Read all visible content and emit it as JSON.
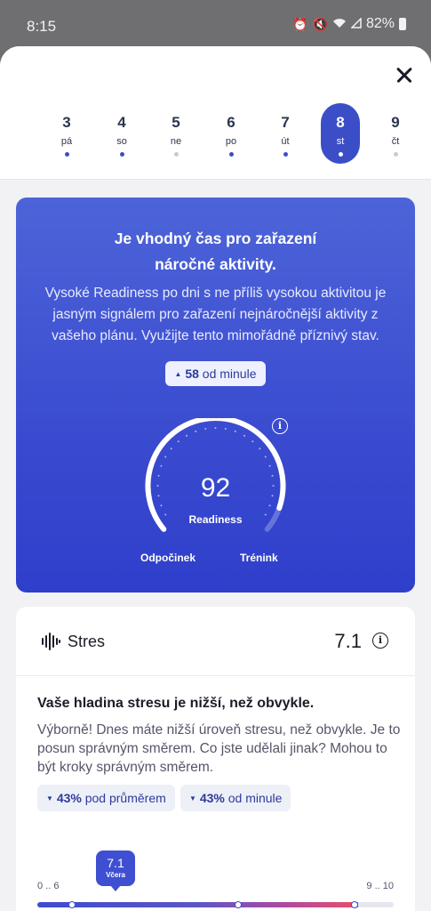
{
  "status_bar": {
    "time": "8:15",
    "battery": "82%"
  },
  "days": [
    {
      "num": "3",
      "weekday": "pá",
      "dot": "filled"
    },
    {
      "num": "4",
      "weekday": "so",
      "dot": "filled"
    },
    {
      "num": "5",
      "weekday": "ne",
      "dot": "faint"
    },
    {
      "num": "6",
      "weekday": "po",
      "dot": "filled"
    },
    {
      "num": "7",
      "weekday": "út",
      "dot": "filled"
    },
    {
      "num": "8",
      "weekday": "st",
      "dot": "filled",
      "selected": true
    },
    {
      "num": "9",
      "weekday": "čt",
      "dot": "faint"
    }
  ],
  "readiness": {
    "title_line1": "Je vhodný čas pro zařazení",
    "title_line2": "náročné aktivity.",
    "description": "Vysoké Readiness po dni s ne příliš vysokou aktivitou je jasným signálem pro zařazení nejnáročnější aktivity z vašeho plánu. Využijte tento mimořádně příznivý stav.",
    "badge_value": "58",
    "badge_text": "od minule",
    "score": "92",
    "score_label": "Readiness",
    "left_label": "Odpočinek",
    "right_label": "Trénink",
    "gauge_fraction": 0.92
  },
  "stress": {
    "title": "Stres",
    "value": "7.1",
    "heading": "Vaše hladina stresu je nižší, než obvykle.",
    "description": "Výborně! Dnes máte nižší úroveň stresu, než obvykle. Je to posun správným směrem. Co jste udělali jinak? Mohou to být kroky správným směrem.",
    "chip1_value": "43%",
    "chip1_text": "pod průměrem",
    "chip2_value": "43%",
    "chip2_text": "od minule",
    "scale_left": "0 .. 6",
    "scale_right": "9 .. 10",
    "marker_value": "7.1",
    "marker_label": "Včera"
  },
  "colors": {
    "accent": "#3b4ec8",
    "card_gradient_top": "#4d64d8",
    "card_gradient_bottom": "#2f3fcb"
  }
}
